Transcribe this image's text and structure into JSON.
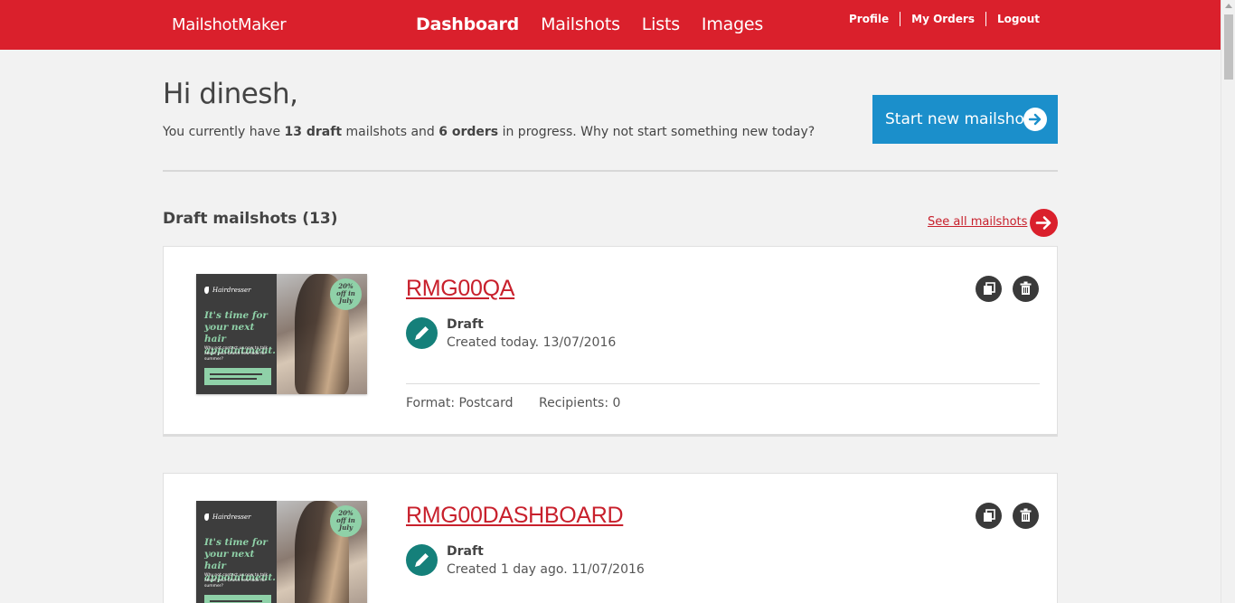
{
  "header": {
    "brand": "MailshotMaker",
    "nav": [
      "Dashboard",
      "Mailshots",
      "Lists",
      "Images"
    ],
    "user_links": [
      "Profile",
      "My Orders",
      "Logout"
    ]
  },
  "intro": {
    "greeting": "Hi dinesh,",
    "summary_prefix": "You currently have ",
    "draft_count": "13",
    "draft_word": "draft",
    "summary_mid": " mailshots and ",
    "orders_text": "6 orders",
    "summary_suffix": " in progress. Why not start something new today?",
    "start_button": "Start new mailshot"
  },
  "drafts": {
    "title": "Draft mailshots (13)",
    "see_all": "See all mailshots",
    "thumbnail": {
      "brand": "Hairdresser",
      "headline": "It's time for your next hair appointment.",
      "body": "Why not contact us now to talk about your brand new look for summer?",
      "badge_line1": "20%",
      "badge_line2": "off in",
      "badge_line3": "July"
    },
    "items": [
      {
        "name": "RMG00QA",
        "status": "Draft",
        "created": "Created today. 13/07/2016",
        "format": "Format: Postcard",
        "recipients": "Recipients: 0"
      },
      {
        "name": "RMG00DASHBOARD",
        "status": "Draft",
        "created": "Created 1 day ago. 11/07/2016"
      }
    ]
  },
  "colors": {
    "brand_red": "#da202c",
    "button_blue": "#1b8fcb",
    "status_teal": "#15807a",
    "thumb_green": "#8fd1a8"
  }
}
